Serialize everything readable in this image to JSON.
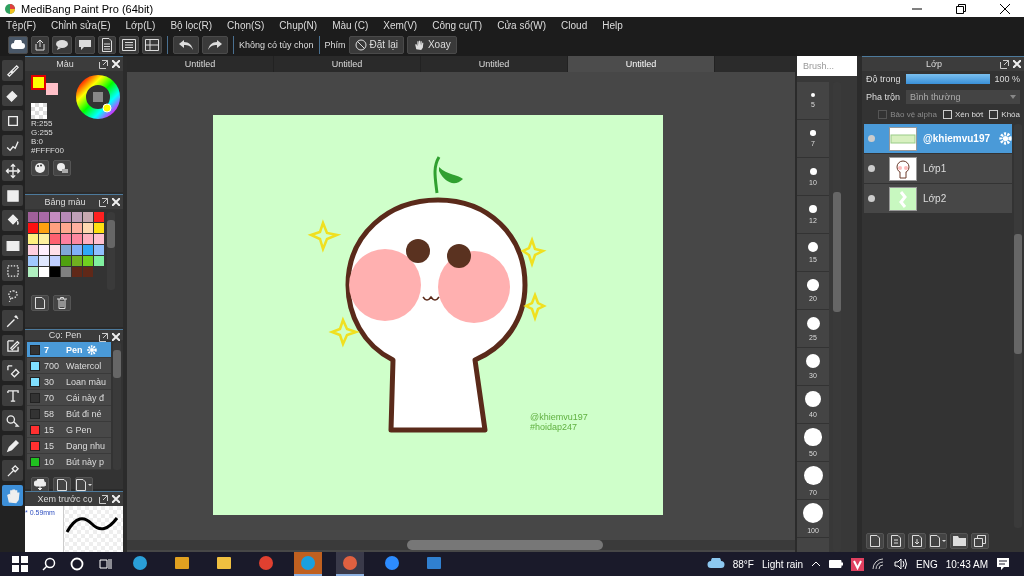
{
  "window": {
    "title": "MediBang Paint Pro (64bit)"
  },
  "menu": [
    "Tệp(F)",
    "Chỉnh sửa(E)",
    "Lớp(L)",
    "Bộ lọc(R)",
    "Chọn(S)",
    "Chụp(N)",
    "Màu (C)",
    "Xem(V)",
    "Công cụ(T)",
    "Cửa sổ(W)",
    "Cloud",
    "Help"
  ],
  "toolbar": {
    "no_options": "Không có tùy chọn",
    "key_label": "Phím",
    "reset": "Đặt lại",
    "rotate": "Xoay"
  },
  "tabs": [
    {
      "label": "Untitled",
      "selected": false
    },
    {
      "label": "Untitled",
      "selected": false
    },
    {
      "label": "Untitled",
      "selected": false
    },
    {
      "label": "Untitled",
      "selected": true
    }
  ],
  "tools": [
    {
      "kind": "brush",
      "selected": false
    },
    {
      "kind": "eraser",
      "selected": false
    },
    {
      "kind": "square",
      "selected": false
    },
    {
      "kind": "zigzag",
      "selected": false
    },
    {
      "kind": "move",
      "selected": false
    },
    {
      "kind": "filled",
      "selected": false
    },
    {
      "kind": "bucket",
      "selected": false
    },
    {
      "kind": "gradient",
      "selected": false
    },
    {
      "kind": "selection",
      "selected": false
    },
    {
      "kind": "lasso",
      "selected": false
    },
    {
      "kind": "wand",
      "selected": false
    },
    {
      "kind": "selpen",
      "selected": false
    },
    {
      "kind": "selerase",
      "selected": false
    },
    {
      "kind": "text",
      "selected": false
    },
    {
      "kind": "pointer",
      "selected": false
    },
    {
      "kind": "pen",
      "selected": false
    },
    {
      "kind": "dropper",
      "selected": false
    },
    {
      "kind": "hand",
      "selected": true
    }
  ],
  "color_panel": {
    "title": "Màu",
    "r": "R:255",
    "g": "G:255",
    "b": "B:0",
    "hex": "#FFFF00"
  },
  "palette_panel": {
    "title": "Bảng màu",
    "swatches": [
      {
        "color": "#a0609a"
      },
      {
        "color": "#a86aa6"
      },
      {
        "color": "#c48cc0"
      },
      {
        "color": "#b88ab8"
      },
      {
        "color": "#c0a0b8"
      },
      {
        "color": "#c8a8b0"
      },
      {
        "color": "#ff2020"
      },
      {
        "color": "#ff1010"
      },
      {
        "color": "#ffa010"
      },
      {
        "color": "#ffa080"
      },
      {
        "color": "#ffa890"
      },
      {
        "color": "#ffb0a0"
      },
      {
        "color": "#ffd8b0"
      },
      {
        "color": "#ffe010"
      },
      {
        "color": "#fff080"
      },
      {
        "color": "#fff0a0"
      },
      {
        "color": "#ff6070"
      },
      {
        "color": "#ff80a0"
      },
      {
        "color": "#ff88a0"
      },
      {
        "color": "#ffb0c0"
      },
      {
        "color": "#ffc0d0"
      },
      {
        "color": "#ffd0e0"
      },
      {
        "color": "#fff0ff"
      },
      {
        "color": "#ffe0e8"
      },
      {
        "color": "#80a8d8"
      },
      {
        "color": "#80b0f8"
      },
      {
        "color": "#30a8f8"
      },
      {
        "color": "#90c0ff"
      },
      {
        "color": "#a0c8ff"
      },
      {
        "color": "#e0e8ff"
      },
      {
        "color": "#c0d0ff"
      },
      {
        "color": "#50a010"
      },
      {
        "color": "#70b020"
      },
      {
        "color": "#70d020"
      },
      {
        "color": "#80f0a0"
      },
      {
        "color": "#b0f0c0"
      },
      {
        "color": "#ffffff"
      },
      {
        "color": "#000000"
      },
      {
        "color": "#808080"
      },
      {
        "color": "#602818"
      },
      {
        "color": "#602818"
      }
    ]
  },
  "brush_panel": {
    "title": "Cọ: Pen",
    "brushes": [
      {
        "size": "7",
        "name": "Pen",
        "color": "#333333",
        "selected": true
      },
      {
        "size": "700",
        "name": "Watercol",
        "color": "#80e0ff",
        "selected": false
      },
      {
        "size": "30",
        "name": "Loan màu",
        "color": "#80e0ff",
        "selected": false
      },
      {
        "size": "70",
        "name": "Cái này đ",
        "color": "#333333",
        "selected": false
      },
      {
        "size": "58",
        "name": "Bút đi né",
        "color": "#333333",
        "selected": false
      },
      {
        "size": "15",
        "name": "G Pen",
        "color": "#ff3030",
        "selected": false
      },
      {
        "size": "15",
        "name": "Dạng nhu",
        "color": "#ff3030",
        "selected": false
      },
      {
        "size": "10",
        "name": "Bút này p",
        "color": "#20c020",
        "selected": false
      }
    ]
  },
  "preview_panel": {
    "title": "Xem trước cọ",
    "size": "* 0.59mm"
  },
  "brush_size_panel": {
    "title": "Brush...",
    "sizes": [
      "5",
      "7",
      "10",
      "12",
      "15",
      "20",
      "25",
      "30",
      "40",
      "50",
      "70",
      "100"
    ]
  },
  "artwork": {
    "signature": "@khiemvu197",
    "tag": "#hoidap247"
  },
  "layer_panel": {
    "title": "Lớp",
    "opacity_label": "Độ trong",
    "opacity": {
      "level": 1
    },
    "opacity_value": "100 %",
    "blend_label": "Pha trộn",
    "blend": "Bình thường",
    "options": [
      {
        "label": "Bảo vệ alpha",
        "checked": false,
        "disabled": true
      },
      {
        "label": "Xén bớt",
        "checked": false,
        "disabled": false
      },
      {
        "label": "Khóa",
        "checked": false,
        "disabled": false
      }
    ],
    "layers": [
      {
        "name": "@khiemvu197",
        "kind": "text",
        "selected": true
      },
      {
        "name": "Lớp1",
        "kind": "character",
        "selected": false
      },
      {
        "name": "Lớp2",
        "kind": "fill",
        "selected": false
      }
    ]
  },
  "taskbar": {
    "apps": [
      {
        "kind": "edge",
        "active": false
      },
      {
        "kind": "store",
        "active": false
      },
      {
        "kind": "folder",
        "active": false
      },
      {
        "kind": "chrome",
        "active": false
      },
      {
        "kind": "skype",
        "active": true
      },
      {
        "kind": "medibang",
        "active": true
      },
      {
        "kind": "zoom",
        "active": false
      },
      {
        "kind": "photos",
        "active": false
      }
    ],
    "temperature": "88°F",
    "weather": "Light rain",
    "language": "ENG",
    "time": "10:43 AM"
  }
}
